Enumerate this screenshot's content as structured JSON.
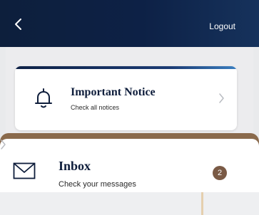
{
  "header": {
    "back_icon": "chevron-left-icon",
    "logout_label": "Logout"
  },
  "notice_card": {
    "icon": "bell-icon",
    "title": "Important Notice",
    "subtitle": "Check all notices"
  },
  "inbox_card": {
    "icon": "mail-icon",
    "title": "Inbox",
    "subtitle": "Check your messages",
    "badge_count": "2"
  },
  "colors": {
    "header_dark": "#0d1f3c",
    "accent_brown": "#7a5a45",
    "sheet_brown": "#8a6a4c",
    "title_navy": "#0e1d3b"
  }
}
